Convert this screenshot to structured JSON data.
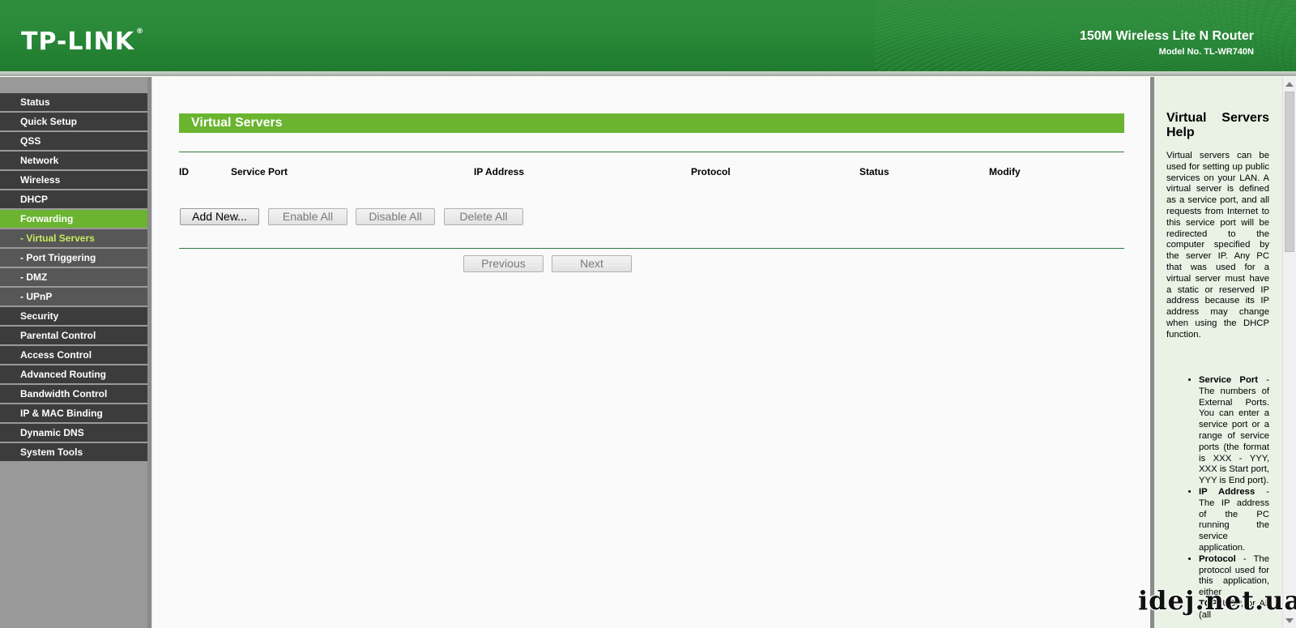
{
  "header": {
    "logo": "TP-LINK",
    "logo_mark": "®",
    "product": "150M Wireless Lite N Router",
    "model": "Model No. TL-WR740N"
  },
  "menu": [
    {
      "label": "Status",
      "sub": false,
      "active": false
    },
    {
      "label": "Quick Setup",
      "sub": false,
      "active": false
    },
    {
      "label": "QSS",
      "sub": false,
      "active": false
    },
    {
      "label": "Network",
      "sub": false,
      "active": false
    },
    {
      "label": "Wireless",
      "sub": false,
      "active": false
    },
    {
      "label": "DHCP",
      "sub": false,
      "active": false
    },
    {
      "label": "Forwarding",
      "sub": false,
      "active": true
    },
    {
      "label": "- Virtual Servers",
      "sub": true,
      "active": true
    },
    {
      "label": "- Port Triggering",
      "sub": true,
      "active": false
    },
    {
      "label": "- DMZ",
      "sub": true,
      "active": false
    },
    {
      "label": "- UPnP",
      "sub": true,
      "active": false
    },
    {
      "label": "Security",
      "sub": false,
      "active": false
    },
    {
      "label": "Parental Control",
      "sub": false,
      "active": false
    },
    {
      "label": "Access Control",
      "sub": false,
      "active": false
    },
    {
      "label": "Advanced Routing",
      "sub": false,
      "active": false
    },
    {
      "label": "Bandwidth Control",
      "sub": false,
      "active": false
    },
    {
      "label": "IP & MAC Binding",
      "sub": false,
      "active": false
    },
    {
      "label": "Dynamic DNS",
      "sub": false,
      "active": false
    },
    {
      "label": "System Tools",
      "sub": false,
      "active": false
    }
  ],
  "main": {
    "title": "Virtual Servers",
    "columns": {
      "id": "ID",
      "service_port": "Service Port",
      "ip_address": "IP Address",
      "protocol": "Protocol",
      "status": "Status",
      "modify": "Modify"
    },
    "buttons": {
      "add_new": "Add New...",
      "enable_all": "Enable All",
      "disable_all": "Disable All",
      "delete_all": "Delete All",
      "previous": "Previous",
      "next": "Next"
    }
  },
  "help": {
    "title": "Virtual Servers Help",
    "intro": "Virtual servers can be used for setting up public services on your LAN. A virtual server is defined as a service port, and all requests from Internet to this service port will be redirected to the computer specified by the server IP. Any PC that was used for a virtual server must have a static or reserved IP address because its IP address may change when using the DHCP function.",
    "items": [
      {
        "term": "Service Port",
        "text": " - The numbers of External Ports. You can enter a service port or a range of service ports (the format is XXX - YYY, XXX is Start port, YYY is End port)."
      },
      {
        "term": "IP Address",
        "text": " - The IP address of the PC running the service application."
      },
      {
        "term": "Protocol",
        "text": " - The protocol used for this application, either "
      },
      {
        "term": "TCP,",
        "text": " UDP, or All (all"
      }
    ]
  },
  "watermark": "idej.net.ua"
}
